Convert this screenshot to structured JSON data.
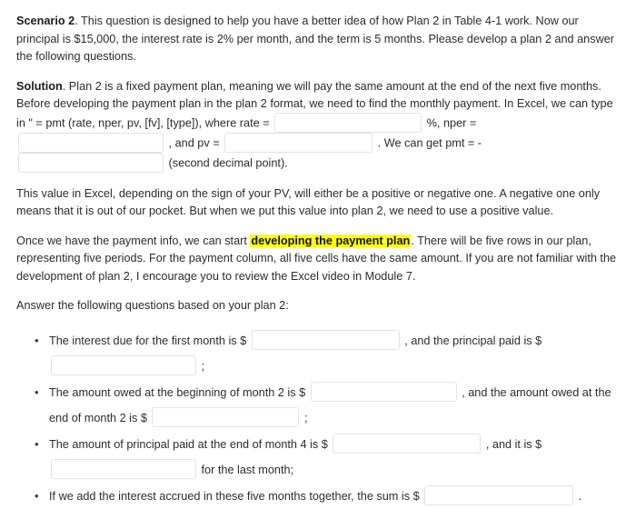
{
  "document": {
    "scenario": {
      "lead": "Scenario 2",
      "body": ". This question is designed to help you have a better idea of how Plan 2 in Table 4-1 work. Now our principal is $15,000, the interest rate is 2% per month, and the term is 5 months. Please develop a plan 2 and answer the following questions."
    },
    "solution": {
      "lead": "Solution",
      "part1": ". Plan 2 is a fixed payment plan, meaning we will pay the same amount at the end of the next five months. Before developing the payment plan in the plan 2 format, we need to find the monthly payment. In Excel, we can type in \" = pmt (rate, nper, pv, [fv], [type]), where rate =",
      "after_rate": "%, nper =",
      "after_nper": ", and pv =",
      "after_pv": ". We can get pmt = -",
      "after_pmt": "(second decimal point)."
    },
    "note_paragraph": "This value in Excel, depending on the sign of your PV, will either be a positive or negative one. A negative one only means that it is out of our pocket. But when we put this value into plan 2, we need to use a positive value.",
    "payment_plan_paragraph": {
      "before_highlight": "Once we have the payment info, we can start ",
      "highlight": "developing the payment plan",
      "after_highlight": ". There will be five rows in our plan, representing five periods. For the payment column, all five cells have the same amount. If you are not familiar with the development of plan 2, I encourage you to review the Excel video in Module 7."
    },
    "answer_prompt": "Answer the following questions based on your plan 2:",
    "questions": [
      {
        "seg1": "The interest due for the first month is $",
        "seg2": ", and the principal paid is $",
        "seg3": ";"
      },
      {
        "seg1": "The amount owed at the beginning of month 2 is $",
        "seg2": ", and the amount owed at the end of month 2 is $",
        "seg3": ";"
      },
      {
        "seg1": "The amount of principal paid at the end of month 4 is $",
        "seg2": ", and it is $",
        "seg3": "for the last month;"
      },
      {
        "seg1": "If we add the interest accrued in these five months together, the sum is $",
        "seg2": "."
      }
    ],
    "fields": {
      "rate": {
        "value": "",
        "placeholder": ""
      },
      "nper": {
        "value": "",
        "placeholder": ""
      },
      "pv": {
        "value": "",
        "placeholder": ""
      },
      "pmt": {
        "value": "",
        "placeholder": ""
      },
      "q1_interest": {
        "value": "",
        "placeholder": ""
      },
      "q1_principal": {
        "value": "",
        "placeholder": ""
      },
      "q2_begin": {
        "value": "",
        "placeholder": ""
      },
      "q2_end": {
        "value": "",
        "placeholder": ""
      },
      "q3_month4": {
        "value": "",
        "placeholder": ""
      },
      "q3_last": {
        "value": "",
        "placeholder": ""
      },
      "q4_sum": {
        "value": "",
        "placeholder": ""
      }
    },
    "colors": {
      "highlight": "#ffff00",
      "text": "#2d2d2d",
      "field_border": "#e2e4e6",
      "background": "#ffffff"
    }
  }
}
